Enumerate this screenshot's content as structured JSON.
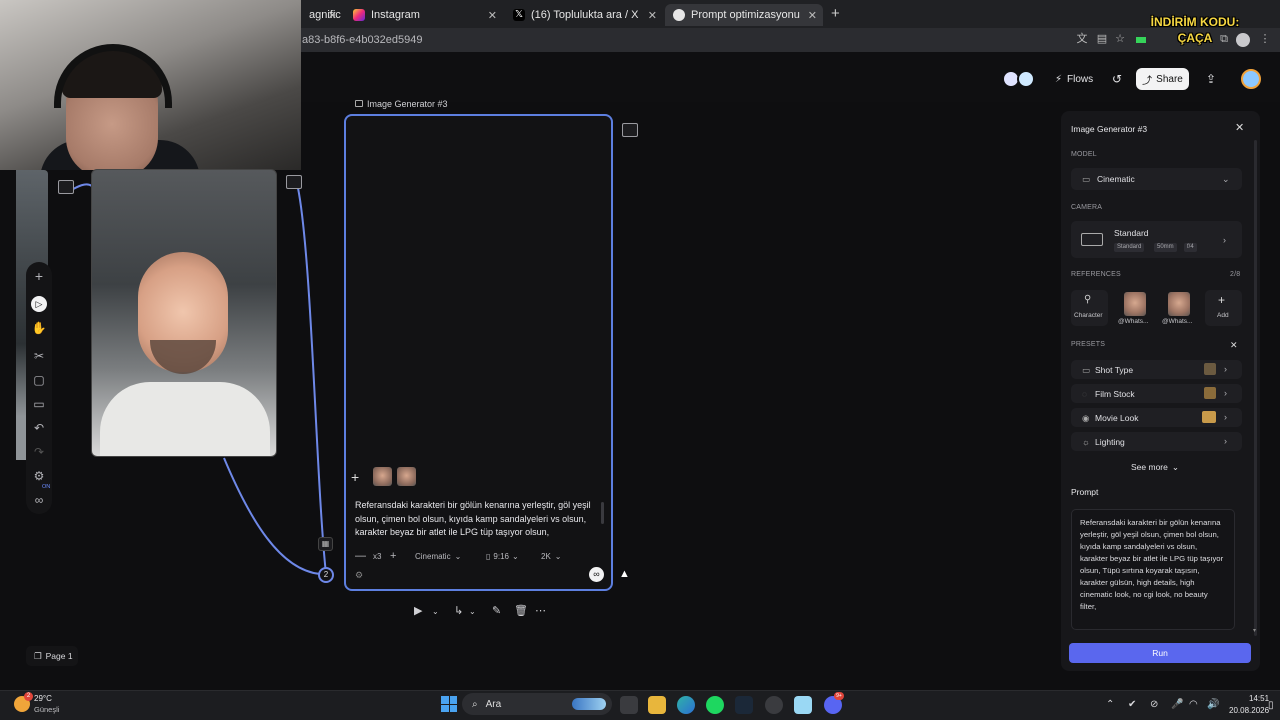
{
  "promo_overlay": {
    "line1": "İNDİRİM KODU:",
    "line2": "ÇAÇA"
  },
  "browser": {
    "tabs": [
      {
        "label": "agnific",
        "active": false
      },
      {
        "label": "Instagram",
        "active": false
      },
      {
        "label": "(16) Toplulukta ara / X",
        "active": false
      },
      {
        "label": "Prompt optimizasyonu",
        "active": true
      }
    ],
    "new_tab_symbol": "+",
    "address": "a83-b8f6-e4b032ed5949"
  },
  "header": {
    "flows_label": "Flows",
    "share_label": "Share"
  },
  "canvas": {
    "generator_label": "Image Generator #3",
    "prompt": "Referansdaki karakteri bir gölün kenarına yerleştir, göl yeşil olsun, çimen bol olsun, kıyıda kamp sandalyeleri vs olsun, karakter beyaz bir atlet ile LPG tüp taşıyor olsun,",
    "batch": "x3",
    "model_chip": "Cinematic",
    "ratio_chip": "9:16",
    "resolution_chip": "2K",
    "edge_badge": "2",
    "toolbar_on_badge": "ON",
    "page_label": "Page 1"
  },
  "panel": {
    "title": "Image Generator #3",
    "model_section": "MODEL",
    "model_value": "Cinematic",
    "camera_section": "CAMERA",
    "camera_value": "Standard",
    "camera_badges": [
      "Standard",
      "50mm",
      "f/4"
    ],
    "references_section": "REFERENCES",
    "references_count": "2/8",
    "references": [
      {
        "label": "Character"
      },
      {
        "label": "@Whats..."
      },
      {
        "label": "@Whats..."
      },
      {
        "label": "Add"
      }
    ],
    "presets_section": "PRESETS",
    "presets": [
      {
        "label": "Shot Type"
      },
      {
        "label": "Film Stock"
      },
      {
        "label": "Movie Look"
      },
      {
        "label": "Lighting"
      }
    ],
    "see_more": "See more",
    "prompt_title": "Prompt",
    "prompt_text": "Referansdaki karakteri bir gölün kenarına yerleştir, göl yeşil olsun, çimen bol olsun, kıyıda kamp sandalyeleri vs olsun, karakter beyaz bir atlet ile LPG tüp taşıyor olsun, Tüpü sırtına koyarak taşısın, karakter gülsün, high details, high cinematic look, no cgi look, no beauty filter,",
    "run_label": "Run"
  },
  "taskbar": {
    "weather_temp": "29°C",
    "weather_desc": "Güneşli",
    "weather_badge": "2",
    "search_placeholder": "Ara",
    "discord_badge": "9+",
    "time": "14:51",
    "date": "20.08.2026"
  },
  "colors": {
    "accent": "#5d7fe0",
    "run_button": "#5a67ee",
    "promo_text": "#f6d742"
  }
}
